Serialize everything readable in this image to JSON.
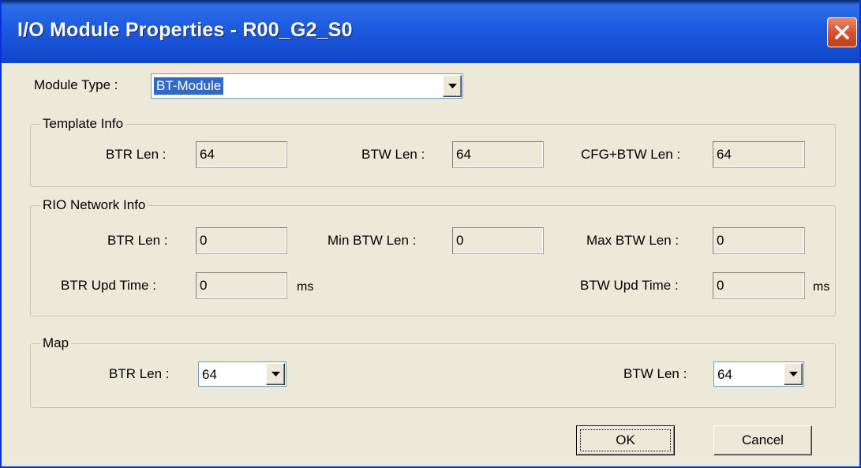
{
  "window": {
    "title": "I/O Module Properties - R00_G2_S0"
  },
  "module_type": {
    "label": "Module Type :",
    "value": "BT-Module"
  },
  "template_info": {
    "legend": "Template Info",
    "btr_len_label": "BTR Len :",
    "btr_len_value": "64",
    "btw_len_label": "BTW Len :",
    "btw_len_value": "64",
    "cfg_btw_len_label": "CFG+BTW Len :",
    "cfg_btw_len_value": "64"
  },
  "rio_network_info": {
    "legend": "RIO Network Info",
    "btr_len_label": "BTR Len :",
    "btr_len_value": "0",
    "min_btw_len_label": "Min BTW  Len :",
    "min_btw_len_value": "0",
    "max_btw_len_label": "Max BTW Len :",
    "max_btw_len_value": "0",
    "btr_upd_time_label": "BTR Upd  Time :",
    "btr_upd_time_value": "0",
    "btw_upd_time_label": "BTW Upd Time :",
    "btw_upd_time_value": "0",
    "unit_ms": "ms"
  },
  "map": {
    "legend": "Map",
    "btr_len_label": "BTR Len :",
    "btr_len_value": "64",
    "btw_len_label": "BTW Len :",
    "btw_len_value": "64"
  },
  "buttons": {
    "ok": "OK",
    "cancel": "Cancel"
  }
}
